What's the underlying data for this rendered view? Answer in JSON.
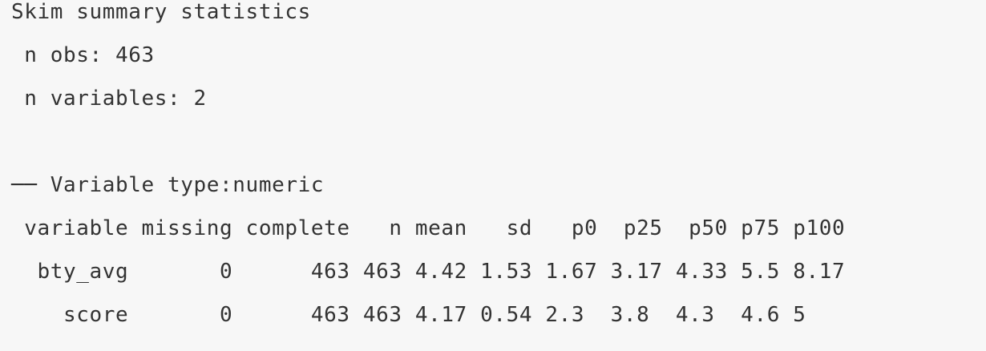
{
  "output": {
    "title": "Skim summary statistics",
    "n_obs": " n obs: 463",
    "n_variables": " n variables: 2",
    "type_header": "── Variable type:numeric",
    "table_header": " variable missing complete   n mean   sd   p0  p25  p50 p75 p100",
    "rows": [
      "  bty_avg       0      463 463 4.42 1.53 1.67 3.17 4.33 5.5 8.17",
      "    score       0      463 463 4.17 0.54 2.3  3.8  4.3  4.6 5"
    ]
  }
}
